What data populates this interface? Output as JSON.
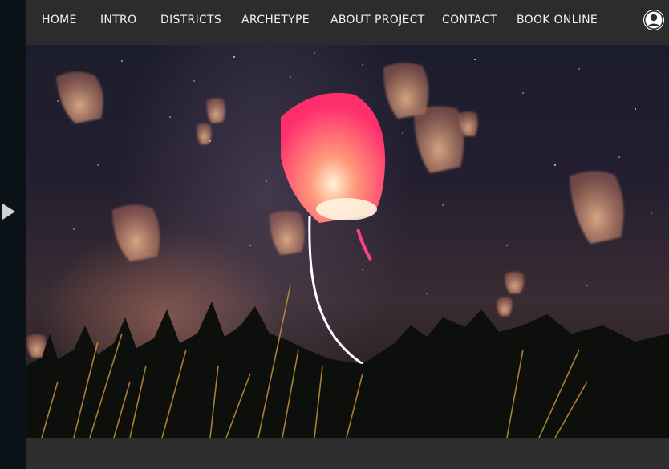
{
  "nav": {
    "items": [
      {
        "label": "HOME"
      },
      {
        "label": "INTRO"
      },
      {
        "label": "DISTRICTS"
      },
      {
        "label": "ARCHETYPE"
      },
      {
        "label": "ABOUT PROJECT"
      },
      {
        "label": "CONTACT"
      },
      {
        "label": "BOOK ONLINE"
      }
    ],
    "account_icon": "user-circle-icon"
  },
  "left_rail": {
    "icon": "play-right-arrow-icon"
  },
  "colors": {
    "navbar_bg": "#2c2c2c",
    "nav_text": "#f2f2f2",
    "lantern_pink": "#ff2f6e",
    "lantern_glow": "#ffb36a",
    "path_line": "#ffffff"
  }
}
